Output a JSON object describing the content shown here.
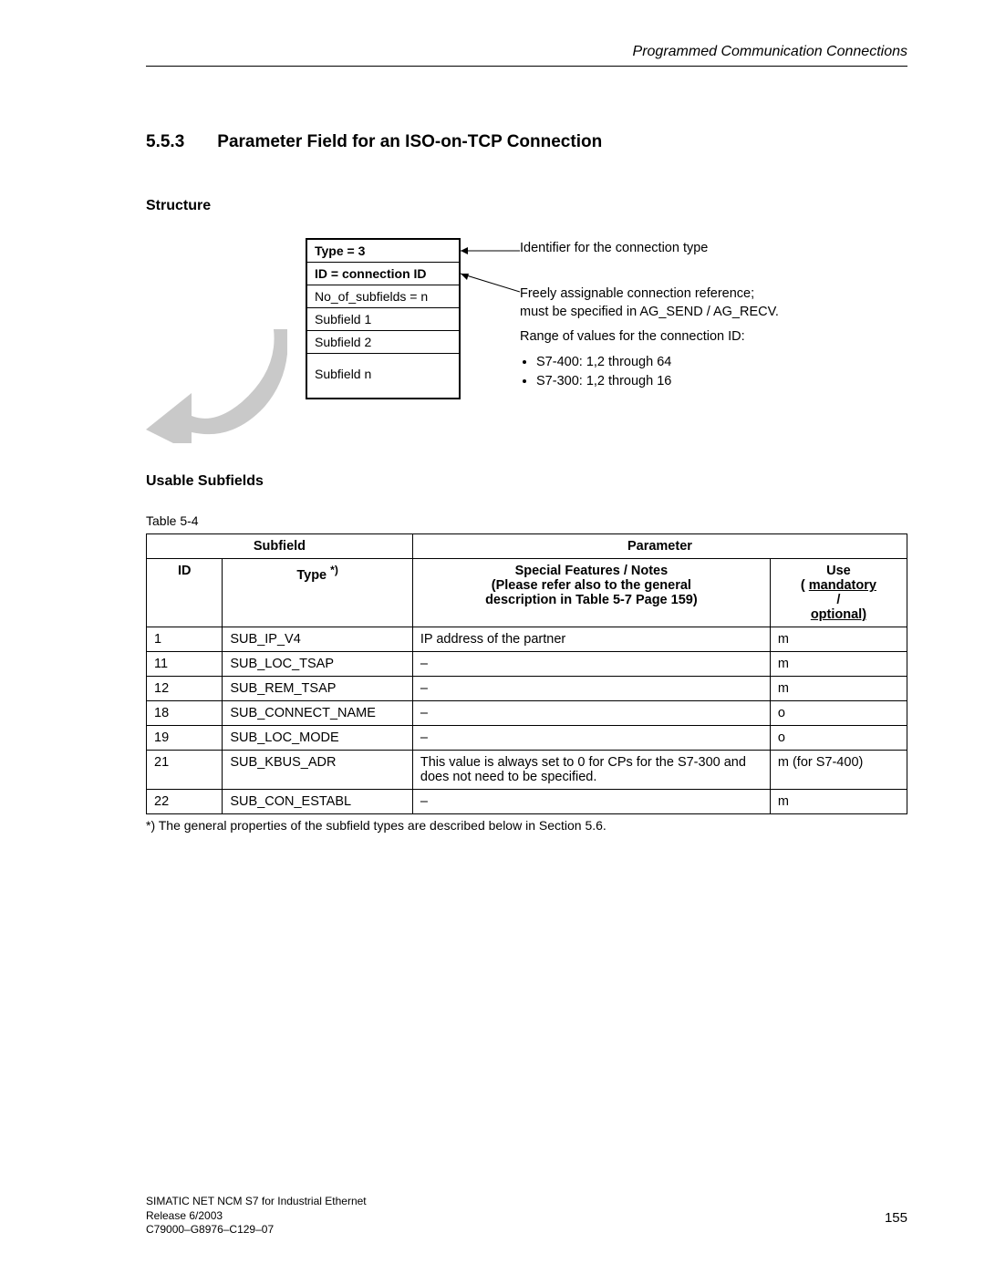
{
  "header": "Programmed Communication Connections",
  "section_num": "5.5.3",
  "section_title": "Parameter Field for an ISO-on-TCP Connection",
  "structure_head": "Structure",
  "struct_rows": {
    "r0": "Type = 3",
    "r1": "ID = connection ID",
    "r2": "No_of_subfields = n",
    "r3": "Subfield 1",
    "r4": "Subfield 2",
    "r5": "Subfield n"
  },
  "anno1": "Identifier for the connection type",
  "anno2a": "Freely assignable connection reference;",
  "anno2b": "must be specified in AG_SEND / AG_RECV.",
  "anno3": "Range of values for the connection ID:",
  "anno_li1": "S7-400: 1,2 through 64",
  "anno_li2": "S7-300: 1,2 through 16",
  "usable_head": "Usable Subfields",
  "table_caption": "Table 5-4",
  "thead": {
    "subfield": "Subfield",
    "parameter": "Parameter",
    "id": "ID",
    "type": "Type",
    "type_sup": "*)",
    "notes_l1": "Special Features / Notes",
    "notes_l2": "(Please refer also to the general",
    "notes_l3": "description in Table 5-7 Page 159)",
    "use": "Use",
    "mandatory": "mandatory",
    "slash": "/",
    "optional": "optional)"
  },
  "rows": [
    {
      "id": "1",
      "type": "SUB_IP_V4",
      "notes": "IP address of the partner",
      "use": "m"
    },
    {
      "id": "11",
      "type": "SUB_LOC_TSAP",
      "notes": "–",
      "use": "m"
    },
    {
      "id": "12",
      "type": "SUB_REM_TSAP",
      "notes": "–",
      "use": "m"
    },
    {
      "id": "18",
      "type": "SUB_CONNECT_NAME",
      "notes": "–",
      "use": "o"
    },
    {
      "id": "19",
      "type": "SUB_LOC_MODE",
      "notes": "–",
      "use": "o"
    },
    {
      "id": "21",
      "type": "SUB_KBUS_ADR",
      "notes": "This value is always set to 0 for CPs for the S7-300 and does not need to be specified.",
      "use": "m (for S7-400)"
    },
    {
      "id": "22",
      "type": "SUB_CON_ESTABL",
      "notes": "–",
      "use": "m"
    }
  ],
  "footnote": "*) The general properties of the subfield types are described below in Section 5.6.",
  "footer": {
    "l1": "SIMATIC NET NCM S7 for Industrial Ethernet",
    "l2": "Release 6/2003",
    "l3": "C79000–G8976–C129–07",
    "page": "155"
  }
}
